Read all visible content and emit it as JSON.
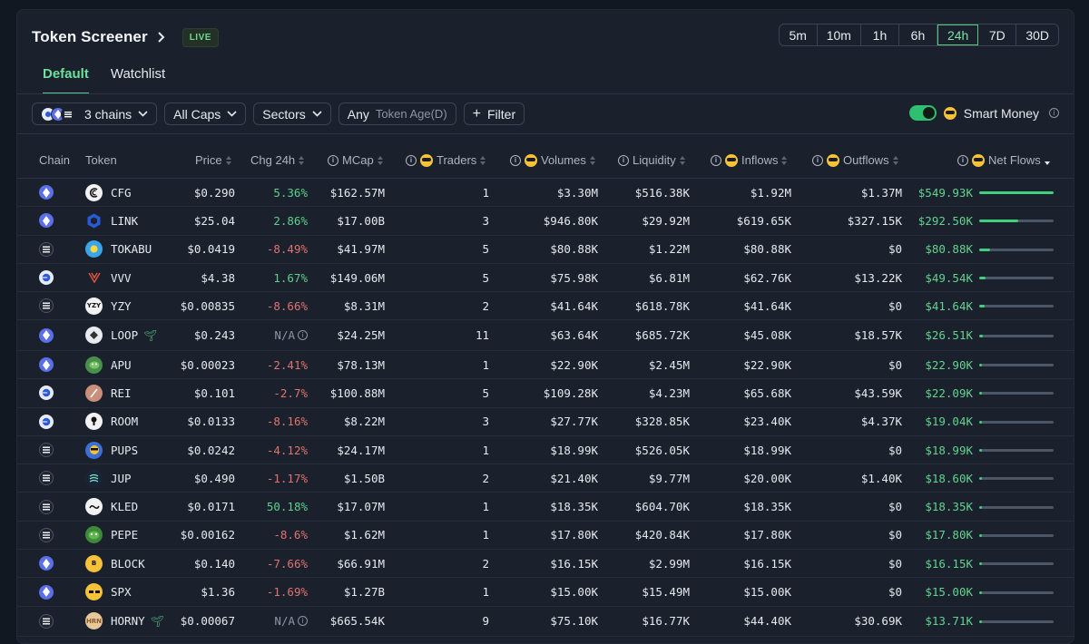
{
  "header": {
    "title": "Token Screener",
    "live_badge": "LIVE"
  },
  "timeframes": [
    "5m",
    "10m",
    "1h",
    "6h",
    "24h",
    "7D",
    "30D"
  ],
  "active_timeframe": "24h",
  "tabs": {
    "default": "Default",
    "watchlist": "Watchlist"
  },
  "filters": {
    "chains": "3 chains",
    "caps": "All Caps",
    "sectors": "Sectors",
    "token_age_any": "Any",
    "token_age_label": "Token Age(D)",
    "filter": "Filter"
  },
  "smart_money": {
    "label": "Smart Money",
    "enabled": true
  },
  "columns": {
    "chain": "Chain",
    "token": "Token",
    "price": "Price",
    "chg24h": "Chg 24h",
    "mcap": "MCap",
    "traders": "Traders",
    "volumes": "Volumes",
    "liquidity": "Liquidity",
    "inflows": "Inflows",
    "outflows": "Outflows",
    "netflows": "Net Flows"
  },
  "colors": {
    "accent": "#55c785",
    "positive": "#5fcf8b",
    "negative": "#e0736e",
    "bar_fill": "#3fcf7d"
  },
  "rows": [
    {
      "chain": "ethereum",
      "token": "CFG",
      "price": "$0.290",
      "chg": "5.36%",
      "dir": "pos",
      "mcap": "$162.57M",
      "traders": "1",
      "volumes": "$3.30M",
      "liquidity": "$516.38K",
      "inflows": "$1.92M",
      "outflows": "$1.37M",
      "netflows": "$549.93K",
      "net_ratio": 1.0
    },
    {
      "chain": "ethereum",
      "token": "LINK",
      "price": "$25.04",
      "chg": "2.86%",
      "dir": "pos",
      "mcap": "$17.00B",
      "traders": "3",
      "volumes": "$946.80K",
      "liquidity": "$29.92M",
      "inflows": "$619.65K",
      "outflows": "$327.15K",
      "netflows": "$292.50K",
      "net_ratio": 0.53
    },
    {
      "chain": "solana",
      "token": "TOKABU",
      "price": "$0.0419",
      "chg": "-8.49%",
      "dir": "neg",
      "mcap": "$41.97M",
      "traders": "5",
      "volumes": "$80.88K",
      "liquidity": "$1.22M",
      "inflows": "$80.88K",
      "outflows": "$0",
      "netflows": "$80.88K",
      "net_ratio": 0.15
    },
    {
      "chain": "base",
      "token": "VVV",
      "price": "$4.38",
      "chg": "1.67%",
      "dir": "pos",
      "mcap": "$149.06M",
      "traders": "5",
      "volumes": "$75.98K",
      "liquidity": "$6.81M",
      "inflows": "$62.76K",
      "outflows": "$13.22K",
      "netflows": "$49.54K",
      "net_ratio": 0.09
    },
    {
      "chain": "solana",
      "token": "YZY",
      "price": "$0.00835",
      "chg": "-8.66%",
      "dir": "neg",
      "mcap": "$8.31M",
      "traders": "2",
      "volumes": "$41.64K",
      "liquidity": "$618.78K",
      "inflows": "$41.64K",
      "outflows": "$0",
      "netflows": "$41.64K",
      "net_ratio": 0.075
    },
    {
      "chain": "ethereum",
      "token": "LOOP",
      "price": "$0.243",
      "chg": "N/A",
      "dir": "na",
      "mcap": "$24.25M",
      "traders": "11",
      "volumes": "$63.64K",
      "liquidity": "$685.72K",
      "inflows": "$45.08K",
      "outflows": "$18.57K",
      "netflows": "$26.51K",
      "net_ratio": 0.05,
      "new": true
    },
    {
      "chain": "ethereum",
      "token": "APU",
      "price": "$0.00023",
      "chg": "-2.41%",
      "dir": "neg",
      "mcap": "$78.13M",
      "traders": "1",
      "volumes": "$22.90K",
      "liquidity": "$2.45M",
      "inflows": "$22.90K",
      "outflows": "$0",
      "netflows": "$22.90K",
      "net_ratio": 0.04
    },
    {
      "chain": "base",
      "token": "REI",
      "price": "$0.101",
      "chg": "-2.7%",
      "dir": "neg",
      "mcap": "$100.88M",
      "traders": "5",
      "volumes": "$109.28K",
      "liquidity": "$4.23M",
      "inflows": "$65.68K",
      "outflows": "$43.59K",
      "netflows": "$22.09K",
      "net_ratio": 0.04
    },
    {
      "chain": "base",
      "token": "ROOM",
      "price": "$0.0133",
      "chg": "-8.16%",
      "dir": "neg",
      "mcap": "$8.22M",
      "traders": "3",
      "volumes": "$27.77K",
      "liquidity": "$328.85K",
      "inflows": "$23.40K",
      "outflows": "$4.37K",
      "netflows": "$19.04K",
      "net_ratio": 0.035
    },
    {
      "chain": "solana",
      "token": "PUPS",
      "price": "$0.0242",
      "chg": "-4.12%",
      "dir": "neg",
      "mcap": "$24.17M",
      "traders": "1",
      "volumes": "$18.99K",
      "liquidity": "$526.05K",
      "inflows": "$18.99K",
      "outflows": "$0",
      "netflows": "$18.99K",
      "net_ratio": 0.035
    },
    {
      "chain": "solana",
      "token": "JUP",
      "price": "$0.490",
      "chg": "-1.17%",
      "dir": "neg",
      "mcap": "$1.50B",
      "traders": "2",
      "volumes": "$21.40K",
      "liquidity": "$9.77M",
      "inflows": "$20.00K",
      "outflows": "$1.40K",
      "netflows": "$18.60K",
      "net_ratio": 0.034
    },
    {
      "chain": "solana",
      "token": "KLED",
      "price": "$0.0171",
      "chg": "50.18%",
      "dir": "pos",
      "mcap": "$17.07M",
      "traders": "1",
      "volumes": "$18.35K",
      "liquidity": "$604.70K",
      "inflows": "$18.35K",
      "outflows": "$0",
      "netflows": "$18.35K",
      "net_ratio": 0.033
    },
    {
      "chain": "solana",
      "token": "PEPE",
      "price": "$0.00162",
      "chg": "-8.6%",
      "dir": "neg",
      "mcap": "$1.62M",
      "traders": "1",
      "volumes": "$17.80K",
      "liquidity": "$420.84K",
      "inflows": "$17.80K",
      "outflows": "$0",
      "netflows": "$17.80K",
      "net_ratio": 0.032
    },
    {
      "chain": "ethereum",
      "token": "BLOCK",
      "price": "$0.140",
      "chg": "-7.66%",
      "dir": "neg",
      "mcap": "$66.91M",
      "traders": "2",
      "volumes": "$16.15K",
      "liquidity": "$2.99M",
      "inflows": "$16.15K",
      "outflows": "$0",
      "netflows": "$16.15K",
      "net_ratio": 0.03
    },
    {
      "chain": "ethereum",
      "token": "SPX",
      "price": "$1.36",
      "chg": "-1.69%",
      "dir": "neg",
      "mcap": "$1.27B",
      "traders": "1",
      "volumes": "$15.00K",
      "liquidity": "$15.49M",
      "inflows": "$15.00K",
      "outflows": "$0",
      "netflows": "$15.00K",
      "net_ratio": 0.028
    },
    {
      "chain": "solana",
      "token": "HORNY",
      "price": "$0.00067",
      "chg": "N/A",
      "dir": "na",
      "mcap": "$665.54K",
      "traders": "9",
      "volumes": "$75.10K",
      "liquidity": "$16.77K",
      "inflows": "$44.40K",
      "outflows": "$30.69K",
      "netflows": "$13.71K",
      "net_ratio": 0.025,
      "new": true
    }
  ]
}
